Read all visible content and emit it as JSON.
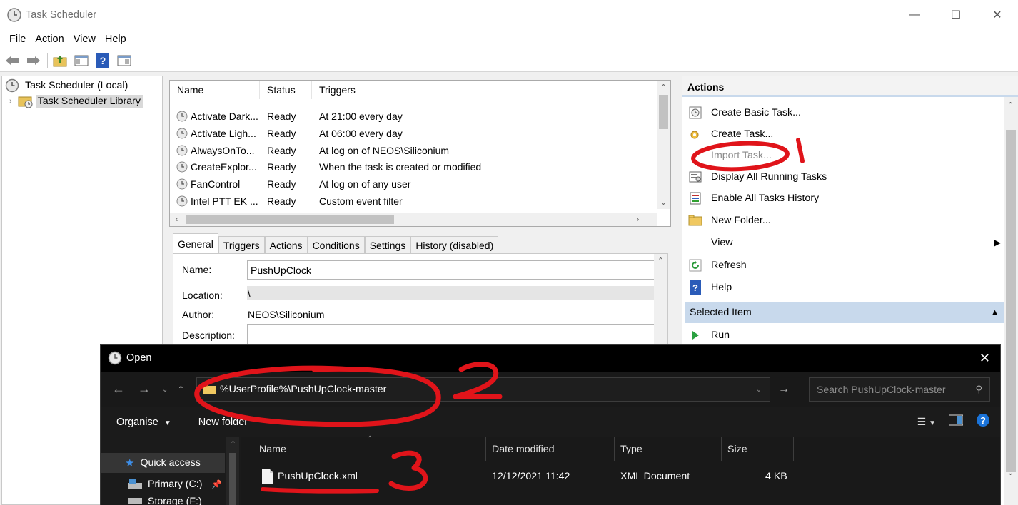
{
  "window": {
    "title": "Task Scheduler"
  },
  "menu": [
    "File",
    "Action",
    "View",
    "Help"
  ],
  "tree": {
    "root": "Task Scheduler (Local)",
    "library": "Task Scheduler Library"
  },
  "task_list": {
    "columns": [
      "Name",
      "Status",
      "Triggers"
    ],
    "rows": [
      {
        "name": "Activate Dark...",
        "status": "Ready",
        "trigger": "At 21:00 every day"
      },
      {
        "name": "Activate Ligh...",
        "status": "Ready",
        "trigger": "At 06:00 every day"
      },
      {
        "name": "AlwaysOnTo...",
        "status": "Ready",
        "trigger": "At log on of NEOS\\Siliconium"
      },
      {
        "name": "CreateExplor...",
        "status": "Ready",
        "trigger": "When the task is created or modified"
      },
      {
        "name": "FanControl",
        "status": "Ready",
        "trigger": "At log on of any user"
      },
      {
        "name": "Intel PTT EK ...",
        "status": "Ready",
        "trigger": "Custom event filter"
      }
    ]
  },
  "details": {
    "tabs": [
      "General",
      "Triggers",
      "Actions",
      "Conditions",
      "Settings",
      "History (disabled)"
    ],
    "name_label": "Name:",
    "name_value": "PushUpClock",
    "location_label": "Location:",
    "location_value": "\\",
    "author_label": "Author:",
    "author_value": "NEOS\\Siliconium",
    "description_label": "Description:"
  },
  "actions": {
    "header": "Actions",
    "items": [
      {
        "label": "Create Basic Task..."
      },
      {
        "label": "Create Task..."
      },
      {
        "label": "Import Task..."
      },
      {
        "label": "Display All Running Tasks"
      },
      {
        "label": "Enable All Tasks History"
      },
      {
        "label": "New Folder..."
      },
      {
        "label": "View"
      },
      {
        "label": "Refresh"
      },
      {
        "label": "Help"
      }
    ],
    "selected_header": "Selected Item",
    "run": "Run"
  },
  "open_dialog": {
    "title": "Open",
    "address": "%UserProfile%\\PushUpClock-master",
    "search_placeholder": "Search PushUpClock-master",
    "organise": "Organise",
    "new_folder": "New folder",
    "nav": [
      "Quick access",
      "Primary (C:)",
      "Storage (F:)"
    ],
    "columns": [
      "Name",
      "Date modified",
      "Type",
      "Size"
    ],
    "file": {
      "name": "PushUpClock.xml",
      "date": "12/12/2021 11:42",
      "type": "XML Document",
      "size": "4 KB"
    }
  },
  "annotations": [
    "1",
    "2",
    "3"
  ],
  "colors": {
    "annotation_red": "#e0141a",
    "selected_blue": "#c8d9ec",
    "dialog_bg": "#202020"
  }
}
